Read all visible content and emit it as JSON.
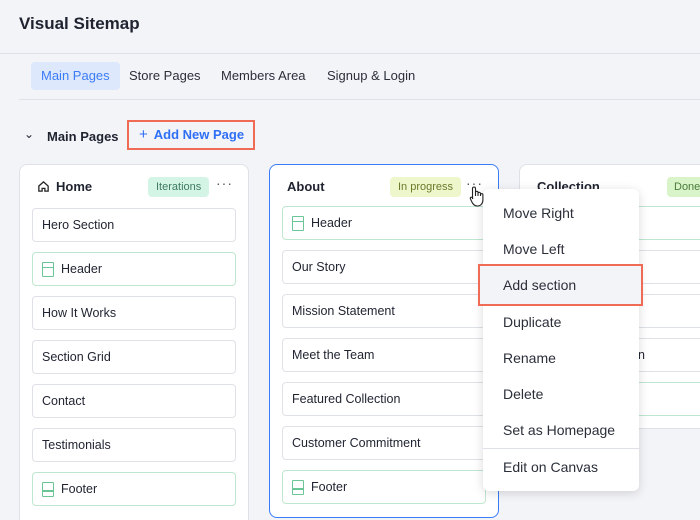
{
  "title": "Visual Sitemap",
  "tabs": [
    {
      "label": "Main Pages",
      "active": true
    },
    {
      "label": "Store Pages"
    },
    {
      "label": "Members Area"
    },
    {
      "label": "Signup & Login"
    }
  ],
  "section": {
    "label": "Main Pages",
    "add_button": "Add New Page",
    "add_icon": "plus-icon",
    "collapse_icon": "chevron-down-icon"
  },
  "colors": {
    "accent": "#3b7cf6",
    "highlight": "#ef6b55",
    "iterations": "#d4f5e6",
    "in_progress": "#eef6cc",
    "done": "#d8f4c8"
  },
  "cards": [
    {
      "title": "Home",
      "icon": "home-icon",
      "badge": "Iterations",
      "items": [
        {
          "label": "Hero Section"
        },
        {
          "label": "Header",
          "type": "header"
        },
        {
          "label": "How It Works"
        },
        {
          "label": "Section Grid"
        },
        {
          "label": "Contact"
        },
        {
          "label": "Testimonials"
        },
        {
          "label": "Footer",
          "type": "footer"
        }
      ]
    },
    {
      "title": "About",
      "badge": "In progress",
      "items": [
        {
          "label": "Header",
          "type": "header"
        },
        {
          "label": "Our Story"
        },
        {
          "label": "Mission Statement"
        },
        {
          "label": "Meet the Team"
        },
        {
          "label": "Featured Collection"
        },
        {
          "label": "Customer Commitment"
        },
        {
          "label": "Footer",
          "type": "footer"
        }
      ]
    },
    {
      "title": "Collection",
      "badge": "Done",
      "items": [
        {
          "label": ""
        },
        {
          "label": ""
        },
        {
          "label": ""
        },
        {
          "label": "n"
        },
        {
          "label": ""
        }
      ]
    }
  ],
  "menu": {
    "items": [
      "Move Right",
      "Move Left",
      "Add section",
      "Duplicate",
      "Rename",
      "Delete",
      "Set as Homepage",
      "Edit on Canvas"
    ],
    "highlighted": "Add section"
  }
}
